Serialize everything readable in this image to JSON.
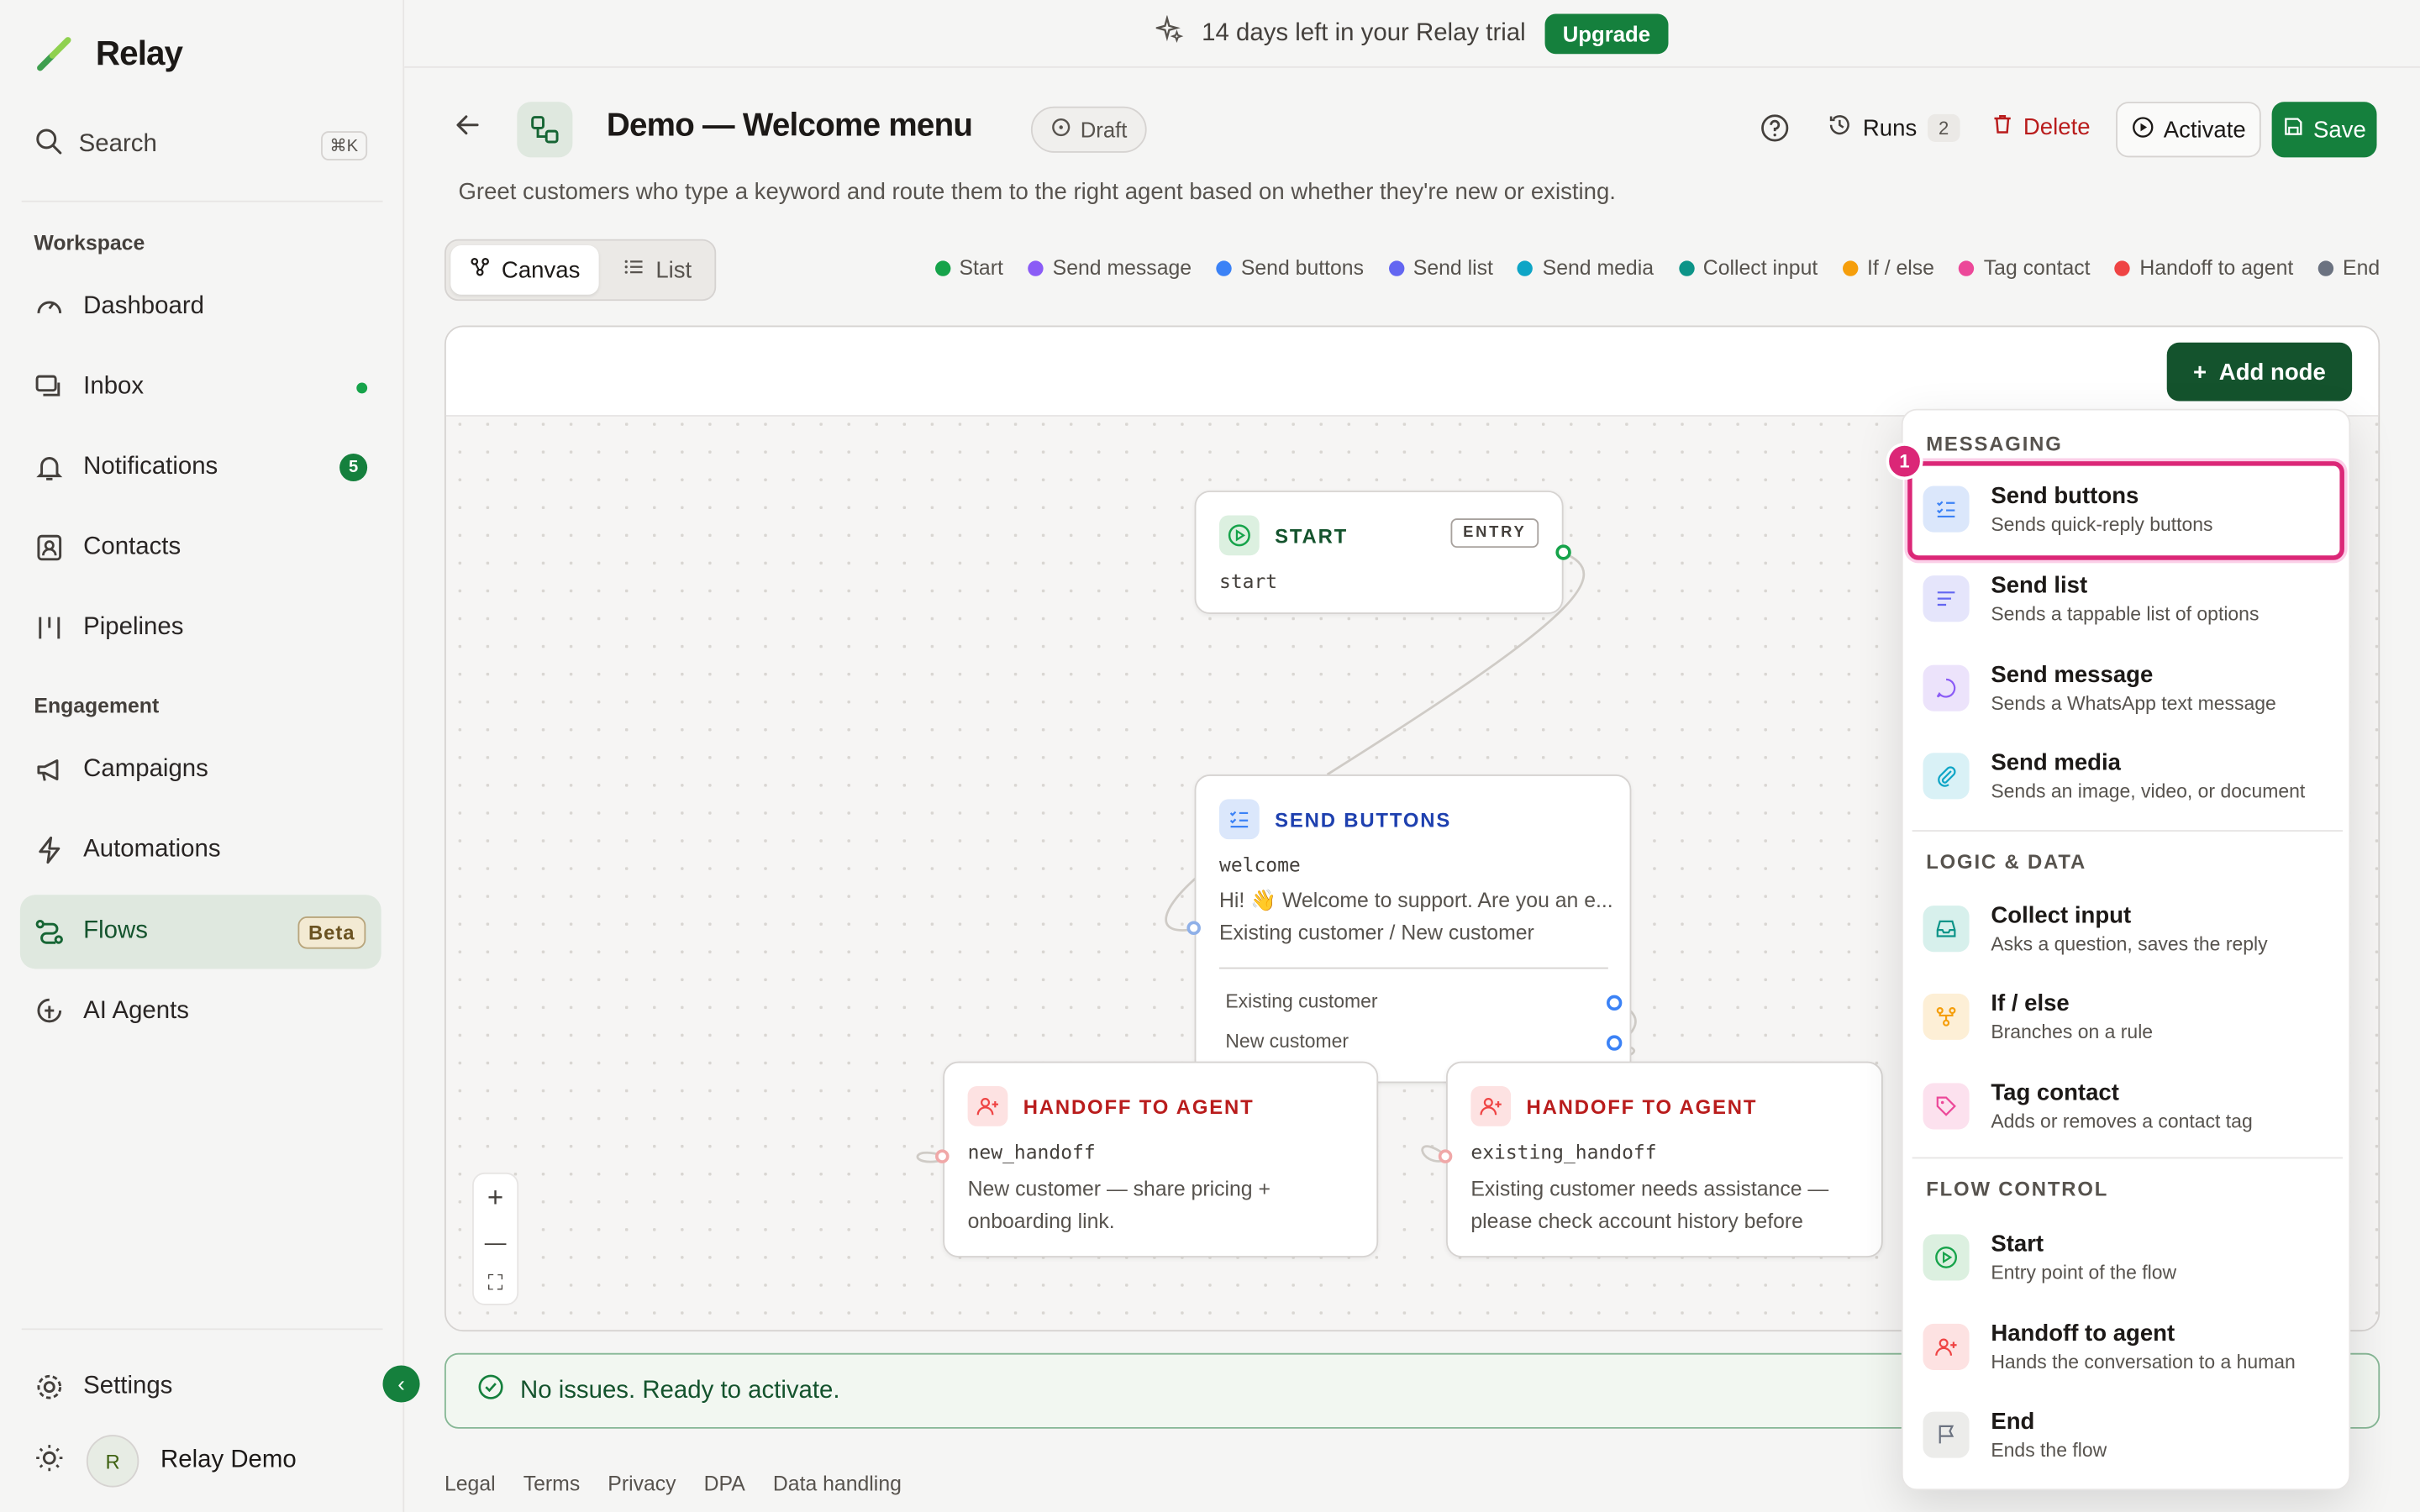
{
  "app": {
    "name": "Relay"
  },
  "trial": {
    "text": "14 days left in your Relay trial",
    "upgrade_label": "Upgrade"
  },
  "sidebar": {
    "search_label": "Search",
    "search_shortcut": "⌘K",
    "section_workspace": "Workspace",
    "section_engagement": "Engagement",
    "items": [
      {
        "label": "Dashboard",
        "icon": "gauge-icon"
      },
      {
        "label": "Inbox",
        "icon": "inbox-icon"
      },
      {
        "label": "Notifications",
        "icon": "bell-icon",
        "count": "5"
      },
      {
        "label": "Contacts",
        "icon": "contact-card-icon"
      },
      {
        "label": "Pipelines",
        "icon": "pipeline-icon"
      },
      {
        "label": "Campaigns",
        "icon": "megaphone-icon"
      },
      {
        "label": "Automations",
        "icon": "bolt-icon"
      },
      {
        "label": "Flows",
        "icon": "flow-icon",
        "badge": "Beta"
      },
      {
        "label": "AI Agents",
        "icon": "bot-icon"
      }
    ],
    "settings_label": "Settings",
    "user": {
      "initial": "R",
      "name": "Relay Demo"
    }
  },
  "header": {
    "title": "Demo — Welcome menu",
    "status": "Draft",
    "runs_label": "Runs",
    "runs_count": "2",
    "delete_label": "Delete",
    "activate_label": "Activate",
    "save_label": "Save",
    "subtitle": "Greet customers who type a keyword and route them to the right agent based on whether they're new or existing."
  },
  "tabs": [
    {
      "label": "Canvas"
    },
    {
      "label": "List"
    }
  ],
  "legend": [
    {
      "label": "Start",
      "color": "#16a34a"
    },
    {
      "label": "Send message",
      "color": "#8b5cf6"
    },
    {
      "label": "Send buttons",
      "color": "#3b82f6"
    },
    {
      "label": "Send list",
      "color": "#6366f1"
    },
    {
      "label": "Send media",
      "color": "#0ea5c6"
    },
    {
      "label": "Collect input",
      "color": "#0d9488"
    },
    {
      "label": "If / else",
      "color": "#f59e0b"
    },
    {
      "label": "Tag contact",
      "color": "#ec4899"
    },
    {
      "label": "Handoff to agent",
      "color": "#ef4444"
    },
    {
      "label": "End",
      "color": "#6b7280"
    }
  ],
  "canvas": {
    "add_node_label": "Add node",
    "nodes": {
      "start": {
        "type": "START",
        "tag": "ENTRY",
        "id": "start"
      },
      "send_buttons": {
        "type": "SEND BUTTONS",
        "id": "welcome",
        "message": "Hi! 👋 Welcome to support. Are you an e...",
        "buttons_summary": "Existing customer / New customer",
        "options": [
          "Existing customer",
          "New customer"
        ]
      },
      "handoff_new": {
        "type": "HANDOFF TO AGENT",
        "id": "new_handoff",
        "text": "New customer — share pricing + onboarding link."
      },
      "handoff_existing": {
        "type": "HANDOFF TO AGENT",
        "id": "existing_handoff",
        "text": "Existing customer needs assistance — please check account history before replyi..."
      }
    },
    "zoom_in": "+",
    "zoom_out": "—",
    "fit": "⛶"
  },
  "status": {
    "text": "No issues. Ready to activate."
  },
  "footer": [
    "Legal",
    "Terms",
    "Privacy",
    "DPA",
    "Data handling"
  ],
  "menu": {
    "badge": "1",
    "sections": {
      "messaging": "MESSAGING",
      "logic": "LOGIC & DATA",
      "flow_control": "FLOW CONTROL"
    },
    "items": [
      {
        "title": "Send buttons",
        "desc": "Sends quick-reply buttons"
      },
      {
        "title": "Send list",
        "desc": "Sends a tappable list of options"
      },
      {
        "title": "Send message",
        "desc": "Sends a WhatsApp text message"
      },
      {
        "title": "Send media",
        "desc": "Sends an image, video, or document"
      },
      {
        "title": "Collect input",
        "desc": "Asks a question, saves the reply"
      },
      {
        "title": "If / else",
        "desc": "Branches on a rule"
      },
      {
        "title": "Tag contact",
        "desc": "Adds or removes a contact tag"
      },
      {
        "title": "Start",
        "desc": "Entry point of the flow"
      },
      {
        "title": "Handoff to agent",
        "desc": "Hands the conversation to a human"
      },
      {
        "title": "End",
        "desc": "Ends the flow"
      }
    ]
  }
}
